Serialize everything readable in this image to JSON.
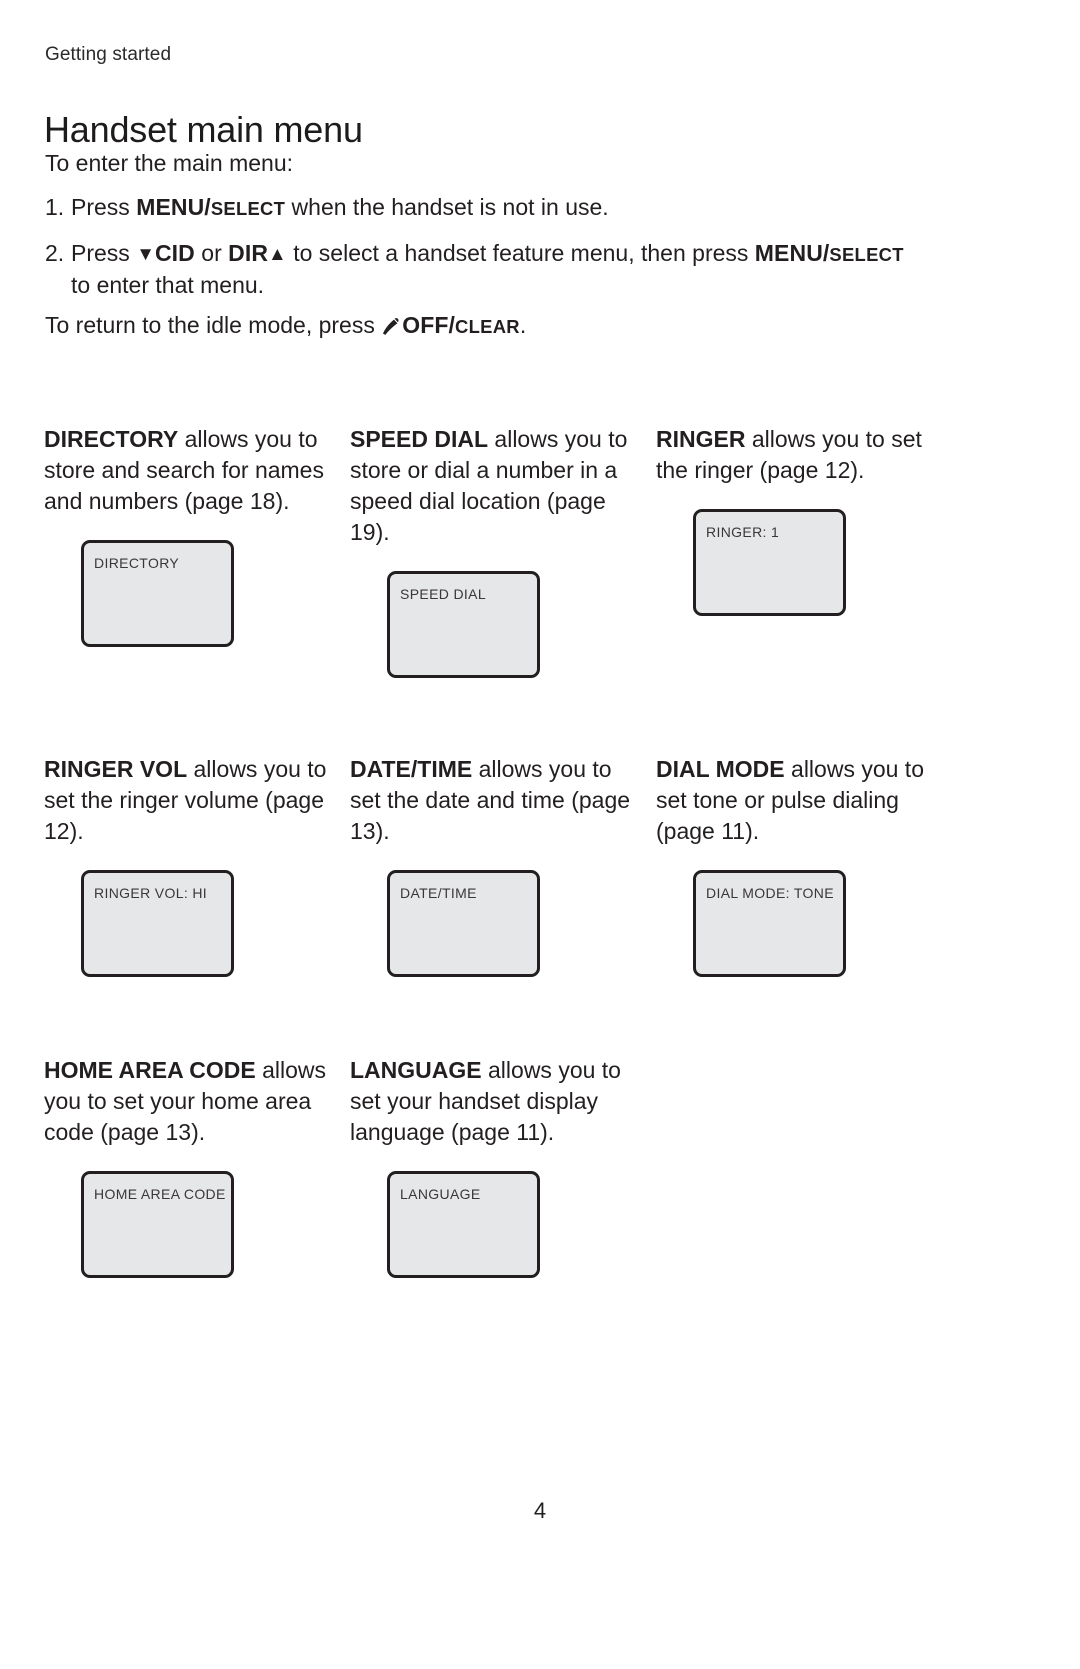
{
  "document": {
    "running_head": "Getting started",
    "title": "Handset main menu",
    "page_number": "4"
  },
  "intro": {
    "lead_in": "To enter the main menu:",
    "closing_prefix": "To return to the idle mode, press ",
    "closing_key_main": "OFF/",
    "closing_key_small": "CLEAR",
    "closing_suffix": "."
  },
  "steps": [
    {
      "number": "1.",
      "text_before": "Press ",
      "key_main": "MENU/",
      "key_small": "SELECT",
      "text_after": " when the handset is not in use."
    },
    {
      "number": "2.",
      "text_before": "Press ",
      "down_arrow": "▼",
      "key_cid": "CID",
      "conjunction": " or ",
      "key_dir": "DIR",
      "up_arrow": "▲",
      "text_middle": " to select a handset feature menu, then press ",
      "key_main2": "MENU/",
      "key_small2": "SELECT",
      "text_after2": " to enter that menu."
    }
  ],
  "features": [
    [
      {
        "name": "DIRECTORY",
        "description": " allows you to store and search for names and numbers (page 18).",
        "lcd_text": "DIRECTORY"
      },
      {
        "name": "SPEED DIAL",
        "description": " allows you to store or dial a number in a speed dial location (page 19).",
        "lcd_text": "SPEED DIAL"
      },
      {
        "name": "RINGER",
        "description": " allows you to set the ringer (page 12).",
        "lcd_text": "RINGER: 1"
      }
    ],
    [
      {
        "name": "RINGER VOL",
        "description": " allows you to set the ringer volume (page 12).",
        "lcd_text": "RINGER VOL: HI"
      },
      {
        "name": "DATE/TIME",
        "description": " allows you to set the date and time (page 13).",
        "lcd_text": "DATE/TIME"
      },
      {
        "name": "DIAL MODE",
        "description": " allows you to set tone or pulse dialing (page 11).",
        "lcd_text": "DIAL MODE: TONE"
      }
    ],
    [
      {
        "name": "HOME AREA CODE",
        "description": " allows you to set your home area code (page 13).",
        "lcd_text": "HOME AREA CODE"
      },
      {
        "name": "LANGUAGE",
        "description": " allows you to set your handset display language (page 11).",
        "lcd_text": "LANGUAGE"
      },
      {
        "name": "",
        "description": "",
        "lcd_text": ""
      }
    ]
  ],
  "colors": {
    "text": "#231f20",
    "lcd_fill": "#e6e7e8",
    "lcd_border": "#231f20"
  }
}
